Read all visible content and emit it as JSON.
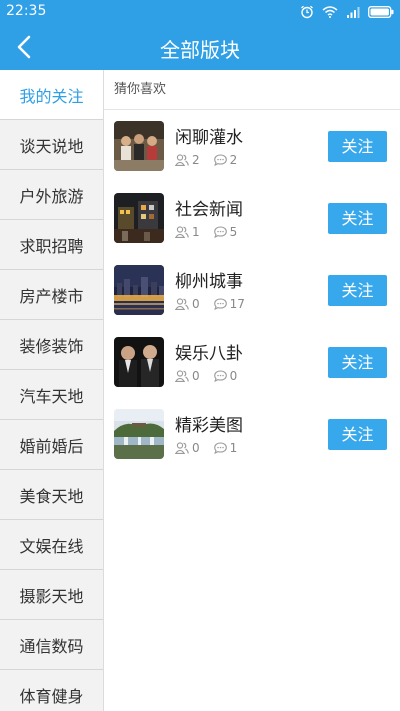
{
  "status": {
    "time": "22:35"
  },
  "header": {
    "title": "全部版块"
  },
  "sidebar": {
    "items": [
      {
        "label": "我的关注"
      },
      {
        "label": "谈天说地"
      },
      {
        "label": "户外旅游"
      },
      {
        "label": "求职招聘"
      },
      {
        "label": "房产楼市"
      },
      {
        "label": "装修装饰"
      },
      {
        "label": "汽车天地"
      },
      {
        "label": "婚前婚后"
      },
      {
        "label": "美食天地"
      },
      {
        "label": "文娱在线"
      },
      {
        "label": "摄影天地"
      },
      {
        "label": "通信数码"
      },
      {
        "label": "体育健身"
      }
    ]
  },
  "main": {
    "section_title": "猜你喜欢",
    "follow_label": "关注",
    "forums": [
      {
        "name": "闲聊灌水",
        "members": "2",
        "posts": "2"
      },
      {
        "name": "社会新闻",
        "members": "1",
        "posts": "5"
      },
      {
        "name": "柳州城事",
        "members": "0",
        "posts": "17"
      },
      {
        "name": "娱乐八卦",
        "members": "0",
        "posts": "0"
      },
      {
        "name": "精彩美图",
        "members": "0",
        "posts": "1"
      }
    ]
  },
  "colors": {
    "accent": "#2f9fe6",
    "button": "#38a8ec",
    "sidebar_bg": "#f2f2f2"
  }
}
